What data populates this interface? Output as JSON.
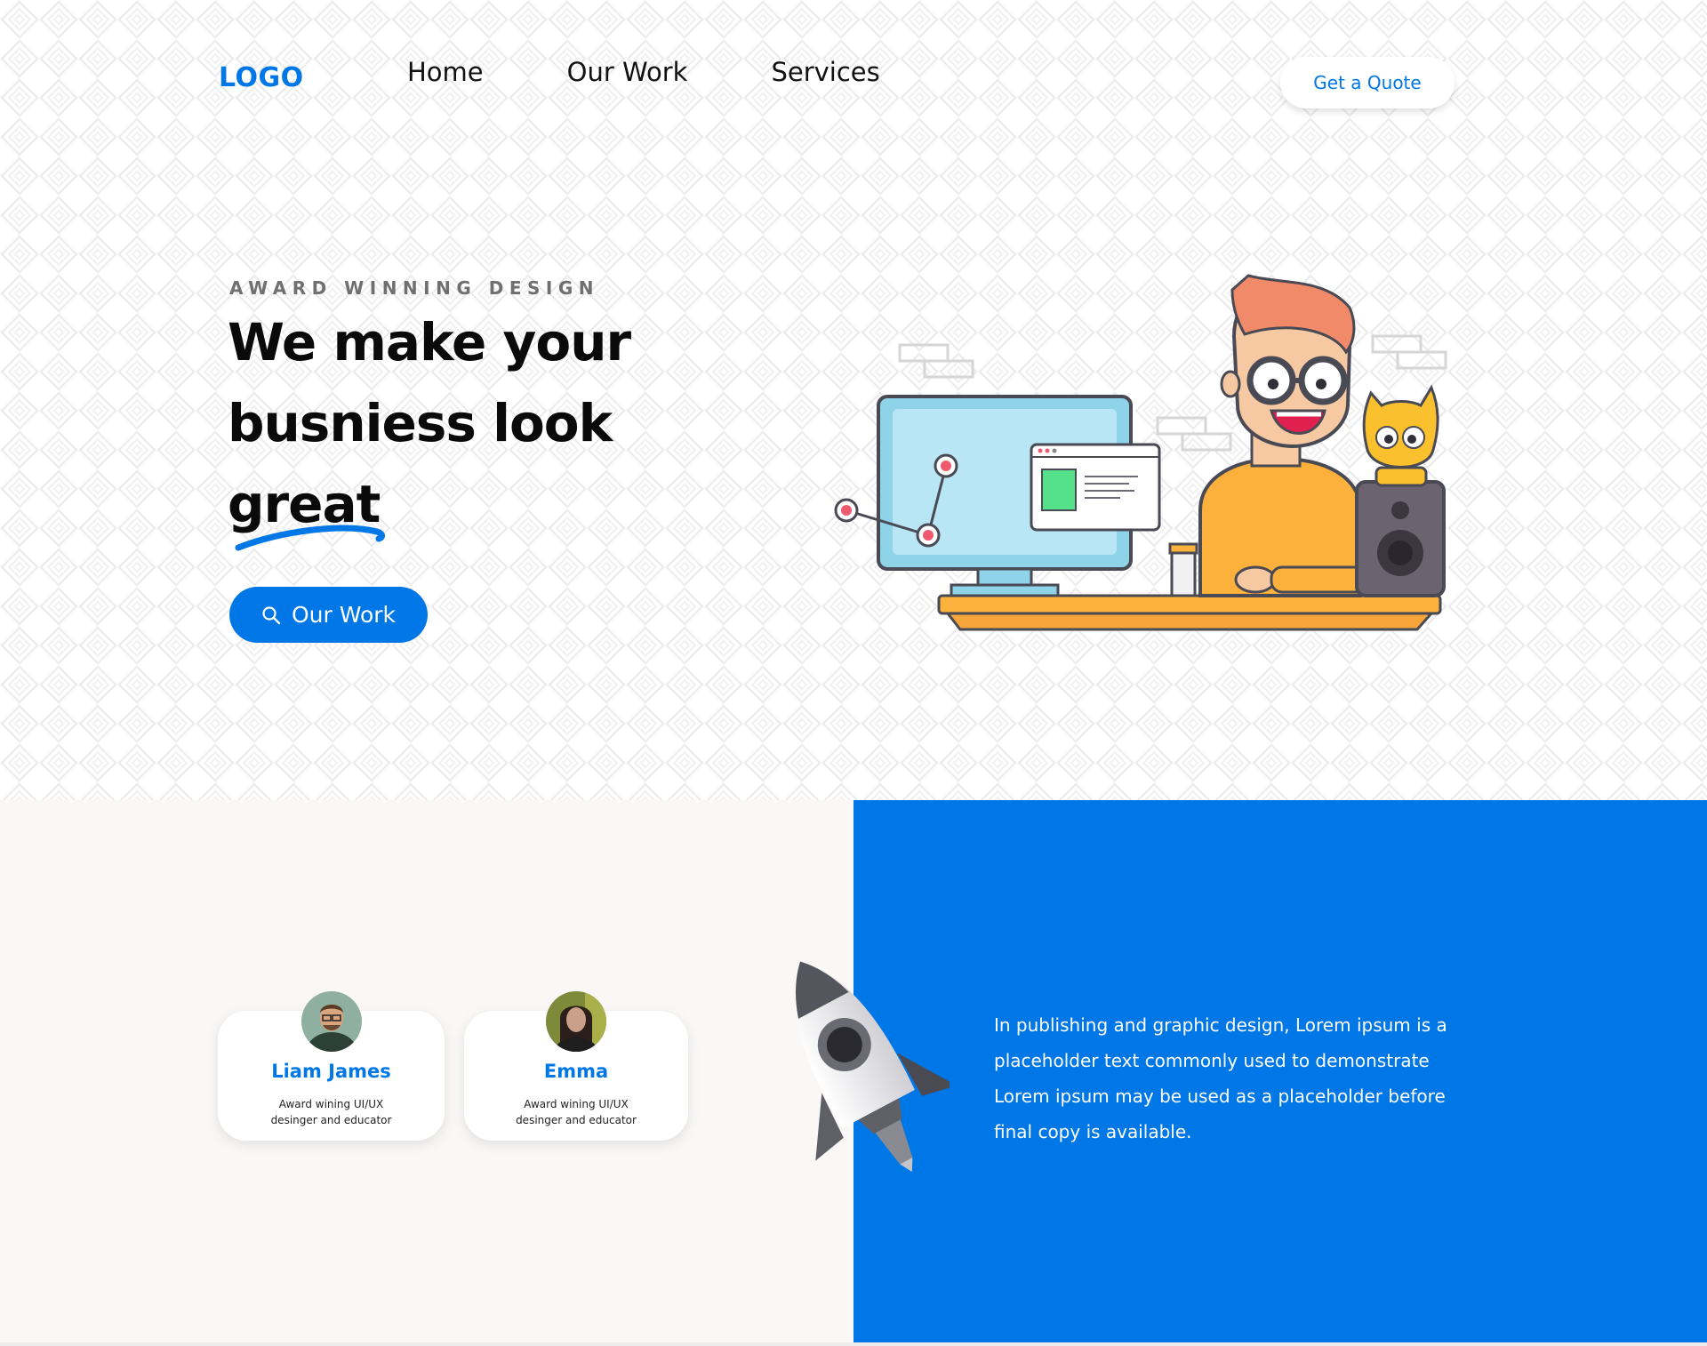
{
  "nav": {
    "logo": "LOGO",
    "links": [
      "Home",
      "Our Work",
      "Services"
    ],
    "quote_label": "Get a Quote"
  },
  "hero": {
    "eyebrow": "AWARD WINNING DESIGN",
    "headline_line1": "We make your",
    "headline_line2": "busniess look",
    "headline_line3": "great",
    "cta_label": "Our Work",
    "cta_icon": "search-icon"
  },
  "team": [
    {
      "name": "Liam James",
      "desc_line1": "Award wining UI/UX",
      "desc_line2": "desinger and educator"
    },
    {
      "name": "Emma",
      "desc_line1": "Award wining UI/UX",
      "desc_line2": "desinger and educator"
    }
  ],
  "about": {
    "text": "In publishing and graphic design, Lorem ipsum is a placeholder text commonly used to demonstrate Lorem ipsum may be used as a placeholder before final copy is available."
  },
  "colors": {
    "accent": "#0077e6",
    "panel_light": "#f9f8f7",
    "panel_blue": "#0077e6"
  }
}
